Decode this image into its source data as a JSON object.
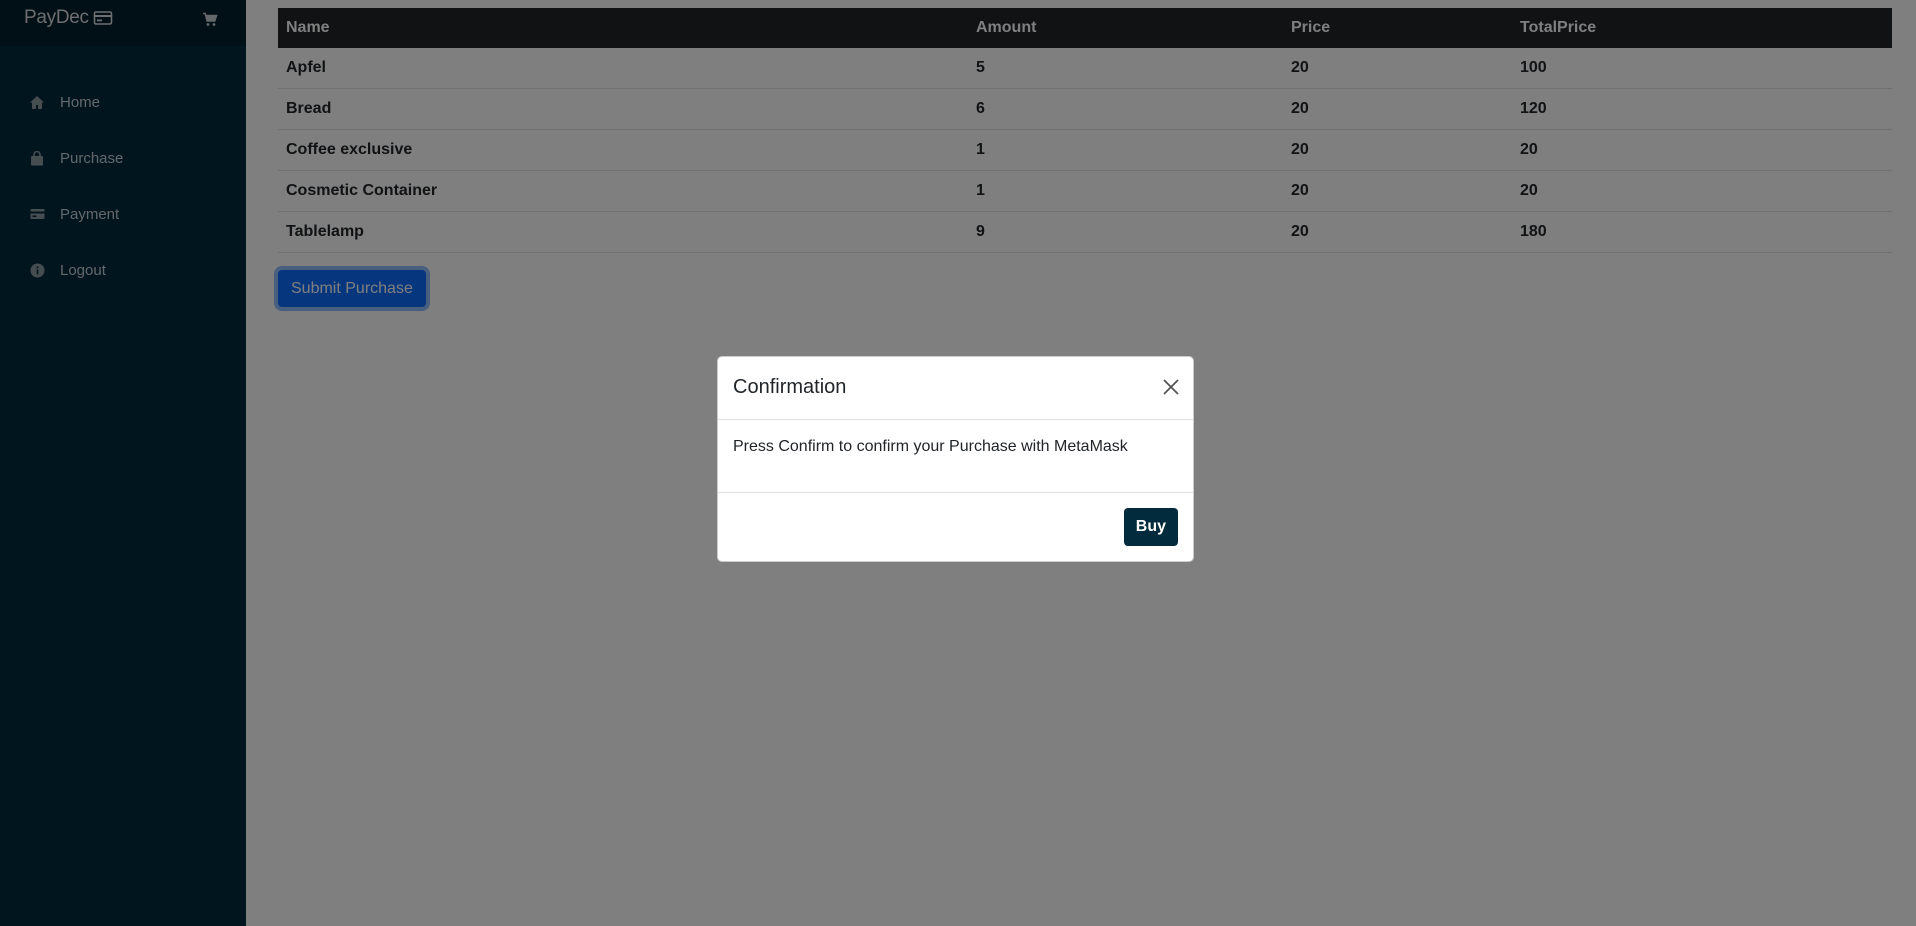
{
  "app": {
    "brand": "PayDec"
  },
  "sidebar": {
    "items": [
      {
        "label": "Home",
        "icon": "home-icon"
      },
      {
        "label": "Purchase",
        "icon": "shopping-bag-icon"
      },
      {
        "label": "Payment",
        "icon": "credit-card-icon"
      },
      {
        "label": "Logout",
        "icon": "info-circle-icon"
      }
    ]
  },
  "table": {
    "headers": [
      "Name",
      "Amount",
      "Price",
      "TotalPrice"
    ],
    "rows": [
      [
        "Apfel",
        "5",
        "20",
        "100"
      ],
      [
        "Bread",
        "6",
        "20",
        "120"
      ],
      [
        "Coffee exclusive",
        "1",
        "20",
        "20"
      ],
      [
        "Cosmetic Container",
        "1",
        "20",
        "20"
      ],
      [
        "Tablelamp",
        "9",
        "20",
        "180"
      ]
    ]
  },
  "actions": {
    "submit_label": "Submit Purchase"
  },
  "modal": {
    "title": "Confirmation",
    "body": "Press Confirm to confirm your Purchase with MetaMask",
    "buy_label": "Buy"
  },
  "colors": {
    "sidebar": "#022b3e",
    "brand_bar": "#021e2c",
    "primary": "#0d6efd",
    "table_header": "#212529"
  }
}
